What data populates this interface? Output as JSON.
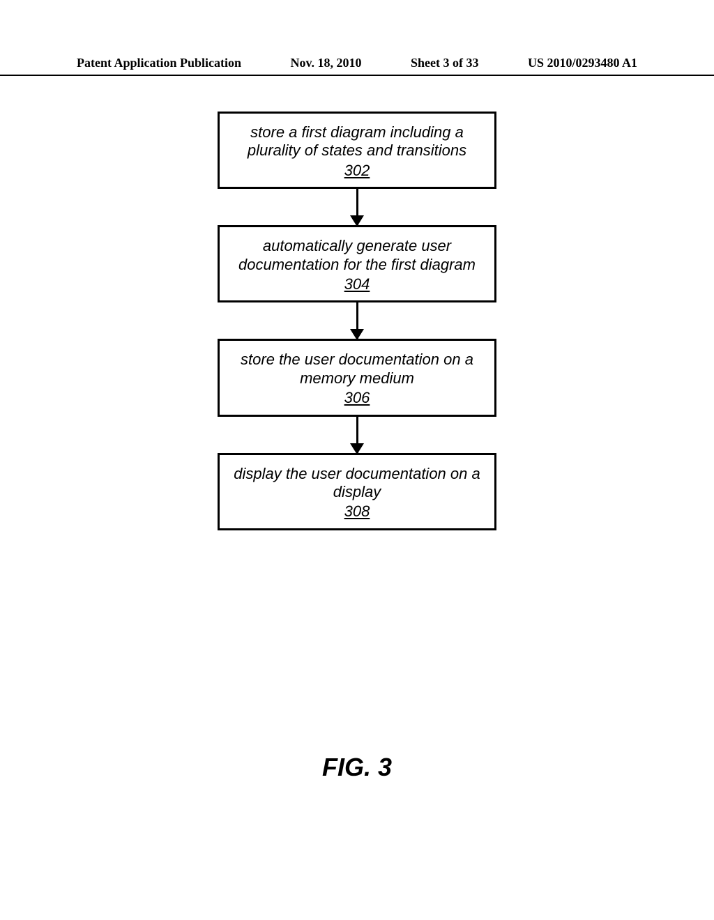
{
  "header": {
    "pub_type": "Patent Application Publication",
    "date": "Nov. 18, 2010",
    "sheet": "Sheet 3 of 33",
    "pub_number": "US 2010/0293480 A1"
  },
  "flow": {
    "boxes": [
      {
        "text": "store a first diagram including a plurality of states and transitions",
        "num": "302"
      },
      {
        "text": "automatically generate user documentation for the first diagram",
        "num": "304"
      },
      {
        "text": "store the user documentation on a memory medium",
        "num": "306"
      },
      {
        "text": "display the user documentation on a display",
        "num": "308"
      }
    ]
  },
  "figure_label": "FIG. 3"
}
